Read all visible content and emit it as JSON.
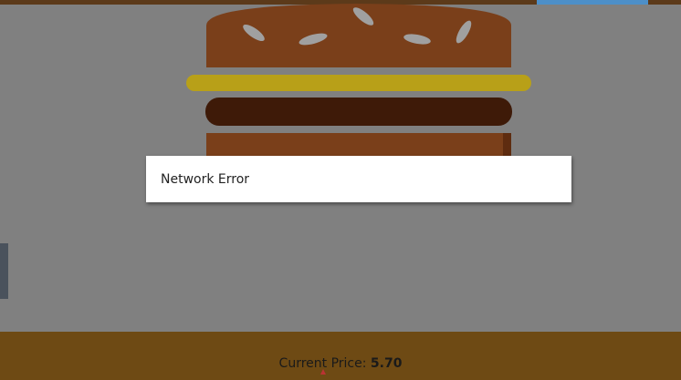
{
  "modal": {
    "message": "Network Error"
  },
  "footer": {
    "price_label": "Current Price:",
    "price_value": "5.70"
  },
  "colors": {
    "backdrop": "#808080",
    "bun": "#7a3f1a",
    "cheese": "#b8a018",
    "patty": "#3e1a08",
    "footer": "#6e4a14"
  }
}
